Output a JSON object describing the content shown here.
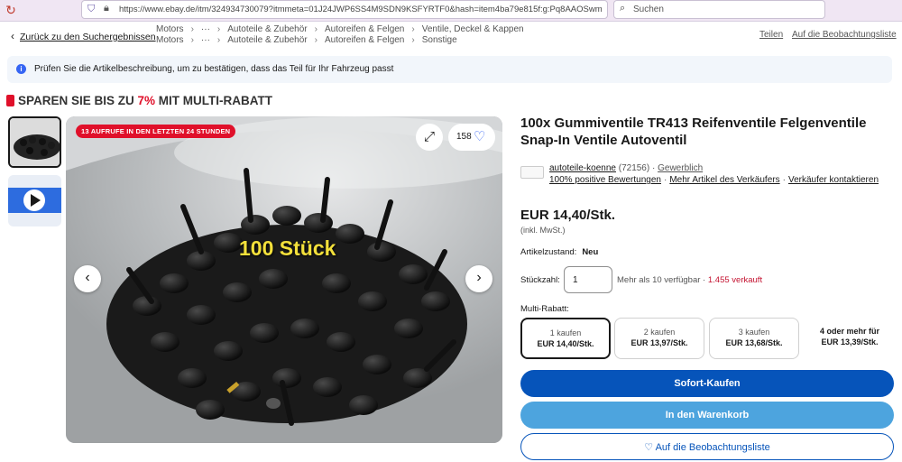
{
  "browser": {
    "url": "https://www.ebay.de/itm/324934730079?itmmeta=01J24JWP6SS4M9SDN9KSFYRTF0&hash=item4ba79e815f:g:Pq8AAOSwmx5jrki8&itm",
    "search_placeholder": "Suchen"
  },
  "nav": {
    "back_label": "Zurück zu den Suchergebnissen",
    "crumbs1": [
      "Motors",
      "Autoteile & Zubehör",
      "Autoreifen & Felgen",
      "Ventile, Deckel & Kappen"
    ],
    "crumbs2": [
      "Motors",
      "Autoteile & Zubehör",
      "Autoreifen & Felgen",
      "Sonstige"
    ],
    "ellipsis": "···",
    "share": "Teilen",
    "watchlist": "Auf die Beobachtungsliste"
  },
  "banner": {
    "text": "Prüfen Sie die Artikelbeschreibung, um zu bestätigen, dass das Teil für Ihr Fahrzeug passt"
  },
  "promo": {
    "prefix": "SPAREN SIE BIS ZU ",
    "percent": "7%",
    "suffix": " MIT MULTI-RABATT"
  },
  "gallery": {
    "badge": "13 AUFRUFE IN DEN LETZTEN 24 STUNDEN",
    "watch_count": "158",
    "overlay_text": "100 Stück"
  },
  "product": {
    "title": "100x Gummiventile TR413 Reifenventile Felgenventile Snap-In Ventile Autoventil",
    "seller_name": "autoteile-koenne",
    "seller_count": "(72156)",
    "seller_type": "Gewerblich",
    "seller_links": [
      "100% positive Bewertungen",
      "Mehr Artikel des Verkäufers",
      "Verkäufer kontaktieren"
    ],
    "price": "EUR 14,40/Stk.",
    "vat": "(inkl. MwSt.)",
    "condition_label": "Artikelzustand:",
    "condition": "Neu",
    "qty_label": "Stückzahl:",
    "qty_value": "1",
    "availability": "Mehr als 10 verfügbar",
    "sold": "1.455 verkauft",
    "multi_label": "Multi-Rabatt:",
    "tiers": [
      {
        "qty": "1 kaufen",
        "price": "EUR 14,40/Stk."
      },
      {
        "qty": "2 kaufen",
        "price": "EUR 13,97/Stk."
      },
      {
        "qty": "3 kaufen",
        "price": "EUR 13,68/Stk."
      },
      {
        "qty": "4 oder mehr für",
        "price": "EUR 13,39/Stk."
      }
    ],
    "buy_now": "Sofort-Kaufen",
    "add_cart": "In den Warenkorb",
    "add_watch": "Auf die Beobachtungsliste"
  },
  "colors": {
    "primary": "#0654ba",
    "secondary": "#4da4de",
    "sale_red": "#e0102a",
    "info_blue": "#3665f3"
  }
}
